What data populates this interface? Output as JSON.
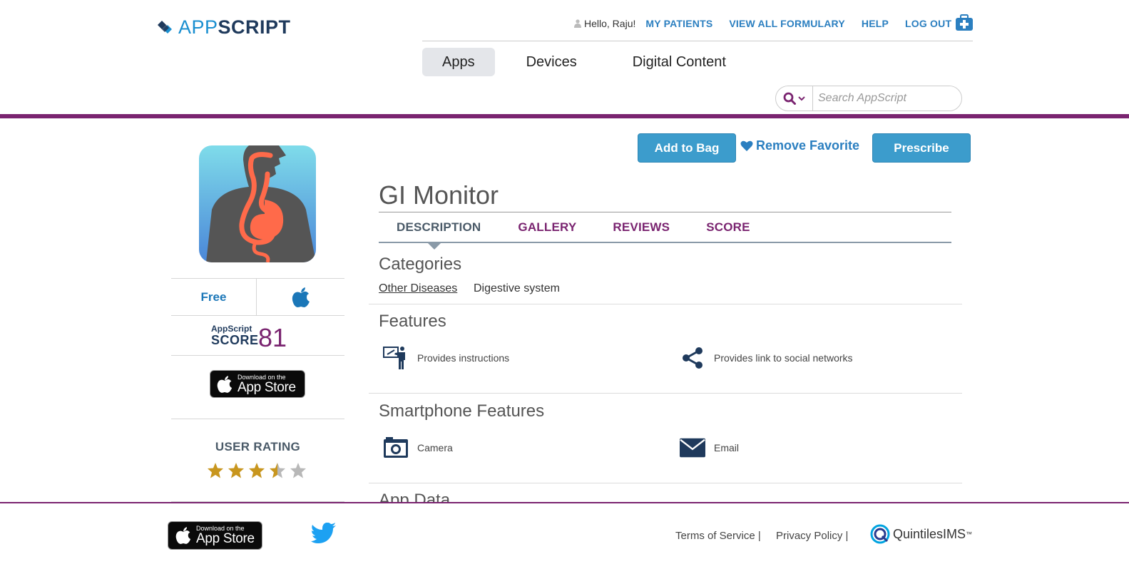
{
  "brand": {
    "app": "APP",
    "script": "SCRIPT"
  },
  "topnav": {
    "greeting": "Hello, Raju!",
    "links": [
      "MY PATIENTS",
      "VIEW ALL FORMULARY",
      "HELP",
      "LOG OUT"
    ]
  },
  "main_tabs": [
    "Apps",
    "Devices",
    "Digital Content"
  ],
  "search": {
    "placeholder": "Search AppScript"
  },
  "app": {
    "title": "GI Monitor",
    "price": "Free",
    "score_label_small": "AppScript",
    "score_label": "SCORE",
    "score": "81",
    "user_rating_title": "USER RATING",
    "user_rating": 3.5,
    "user_rating_max": 5
  },
  "appstore_badge": {
    "line1": "Download on the",
    "line2": "App Store"
  },
  "actions": {
    "add_to_bag": "Add to Bag",
    "remove_favorite": "Remove Favorite",
    "prescribe": "Prescribe"
  },
  "detail_tabs": [
    "DESCRIPTION",
    "GALLERY",
    "REVIEWS",
    "SCORE"
  ],
  "categories": {
    "title": "Categories",
    "items": [
      "Other Diseases",
      "Digestive system"
    ]
  },
  "features": {
    "title": "Features",
    "items": [
      "Provides instructions",
      "Provides link to social networks"
    ]
  },
  "smartphone_features": {
    "title": "Smartphone Features",
    "items": [
      "Camera",
      "Email"
    ]
  },
  "app_data": {
    "title": "App Data"
  },
  "footer": {
    "terms": "Terms of Service |",
    "privacy": "Privacy Policy |",
    "company": "QuintilesIMS",
    "tm": "™"
  },
  "colors": {
    "accent": "#7a2470",
    "button": "#3c9ccc",
    "link": "#2b7fc0",
    "navy": "#1f3a5c"
  },
  "icons": [
    "user-icon",
    "medical-bag-icon",
    "search-icon",
    "chevron-down-icon",
    "apple-icon",
    "heart-icon",
    "instructions-icon",
    "share-icon",
    "camera-icon",
    "email-icon",
    "twitter-icon",
    "star-icon"
  ]
}
